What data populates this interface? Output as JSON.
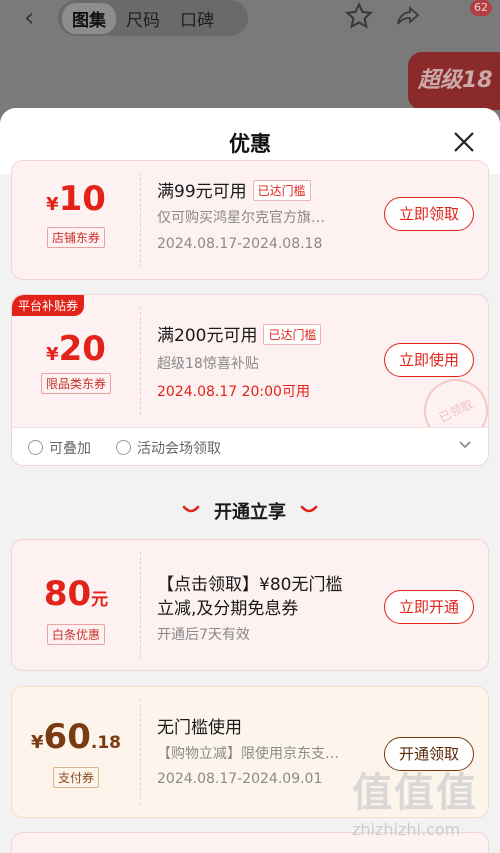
{
  "topbar": {
    "tabs": [
      "图集",
      "尺码",
      "口碑"
    ],
    "cart_count": "62",
    "promo_text": "超级18"
  },
  "sheet": {
    "title": "优惠",
    "coupons": [
      {
        "symbol": "¥",
        "amount": "10",
        "tag": "店铺东券",
        "title": "满99元可用",
        "badge": "已达门槛",
        "desc": "仅可购买鸿星尔克官方旗…",
        "date": "2024.08.17-2024.08.18",
        "action": "立即领取"
      },
      {
        "platform_badge": "平台补贴券",
        "symbol": "¥",
        "amount": "20",
        "tag": "限品类东券",
        "title": "满200元可用",
        "badge": "已达门槛",
        "desc": "超级18惊喜补贴",
        "date": "2024.08.17 20:00可用",
        "action": "立即使用",
        "stamp": "已领取",
        "footer": [
          "可叠加",
          "活动会场领取"
        ]
      }
    ],
    "section_title": "开通立享",
    "offers": [
      {
        "amount": "80",
        "unit": "元",
        "tag": "白条优惠",
        "title_line1": "【点击领取】¥80无门槛",
        "title_line2": "立减,及分期免息券",
        "desc": "开通后7天有效",
        "action": "立即开通"
      },
      {
        "symbol": "¥",
        "amount": "60",
        "decimal": ".18",
        "tag": "支付券",
        "title": "无门槛使用",
        "desc": "【购物立减】限使用京东支…",
        "date": "2024.08.17-2024.09.01",
        "action": "开通领取"
      }
    ]
  },
  "watermark": {
    "text": "值值值",
    "url": "zhizhizhi.com"
  },
  "colors": {
    "accent": "#e2231a",
    "card_bg": "#fdf1f1",
    "gold_bg": "#fdf5ec"
  }
}
